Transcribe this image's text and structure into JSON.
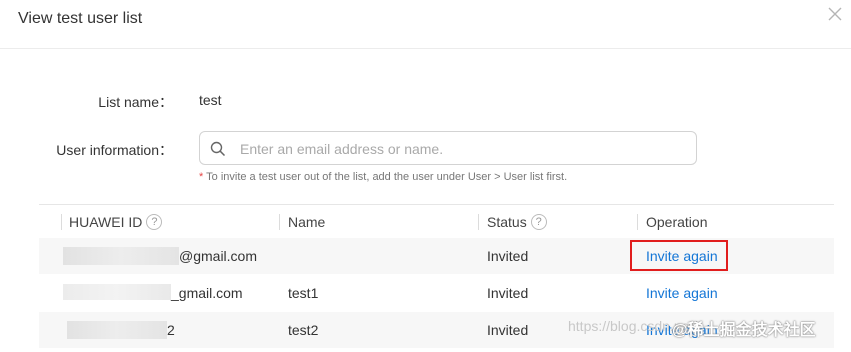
{
  "dialog": {
    "title": "View test user list",
    "close_icon": "close-icon"
  },
  "form": {
    "list_name_label": "List name：",
    "list_name_value": "test",
    "user_info_label": "User information：",
    "search_icon": "search-icon",
    "search_placeholder": "Enter an email address or name.",
    "hint_star": "*",
    "hint_text": " To invite a test user out of the list, add the user under User > User list first."
  },
  "table": {
    "columns": [
      "HUAWEI ID",
      "Name",
      "Status",
      "Operation"
    ],
    "help_icon": "?",
    "rows": [
      {
        "huawei_id_visible": "@gmail.com",
        "name": "",
        "status": "Invited",
        "operation": "Invite again",
        "highlighted": true
      },
      {
        "huawei_id_visible": "_gmail.com",
        "name": "test1",
        "status": "Invited",
        "operation": "Invite again",
        "highlighted": false
      },
      {
        "huawei_id_visible": "2",
        "name": "test2",
        "status": "Invited",
        "operation": "Invite again",
        "highlighted": false
      }
    ]
  },
  "watermark": {
    "url": "https://blog.csdn.net/",
    "brand": "@稀土掘金技术社区"
  },
  "colors": {
    "link": "#1476d6",
    "highlight_box": "#e11d1d",
    "hint_star": "#e64545"
  }
}
